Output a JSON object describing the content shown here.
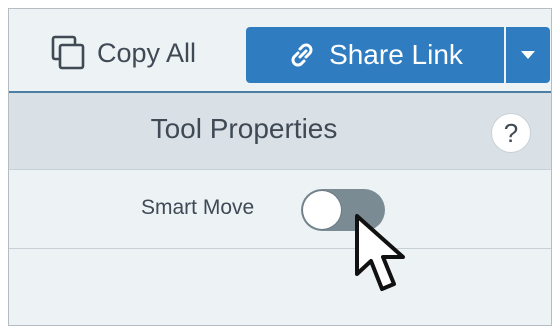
{
  "toolbar": {
    "copy_all_label": "Copy All",
    "copy_icon": "copy-icon",
    "share_link_label": "Share Link",
    "share_link_icon": "link-icon",
    "share_dropdown_icon": "caret-down-icon"
  },
  "panel": {
    "title": "Tool Properties",
    "help_label": "?"
  },
  "smart_move": {
    "label": "Smart Move",
    "toggle_on": false
  },
  "colors": {
    "accent": "#2f7cc0",
    "toggle_track": "#7b8b94",
    "text": "#3f4a55"
  }
}
